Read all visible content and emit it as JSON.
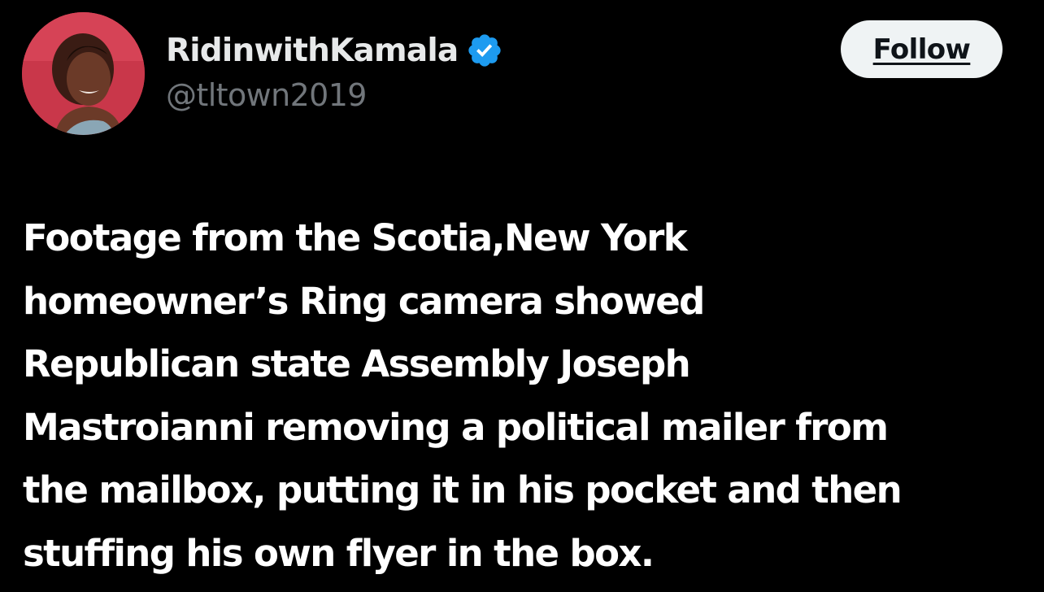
{
  "author": {
    "display_name": "RidinwithKamala",
    "handle": "@tltown2019",
    "verified_icon": "verified-badge-icon",
    "avatar_icon": "user-avatar"
  },
  "actions": {
    "follow_label": "Follow"
  },
  "tweet": {
    "lines": [
      "Footage from the Scotia,New York",
      "homeowner’s Ring camera showed",
      "Republican state Assembly Joseph",
      "Mastroianni removing a political mailer from",
      "the mailbox, putting it in his pocket and then",
      "stuffing his own flyer in the box."
    ]
  },
  "colors": {
    "background": "#000000",
    "text_primary": "#ffffff",
    "text_secondary": "#71767b",
    "verified_blue": "#1d9bf0",
    "follow_button_bg": "#eff3f4"
  }
}
